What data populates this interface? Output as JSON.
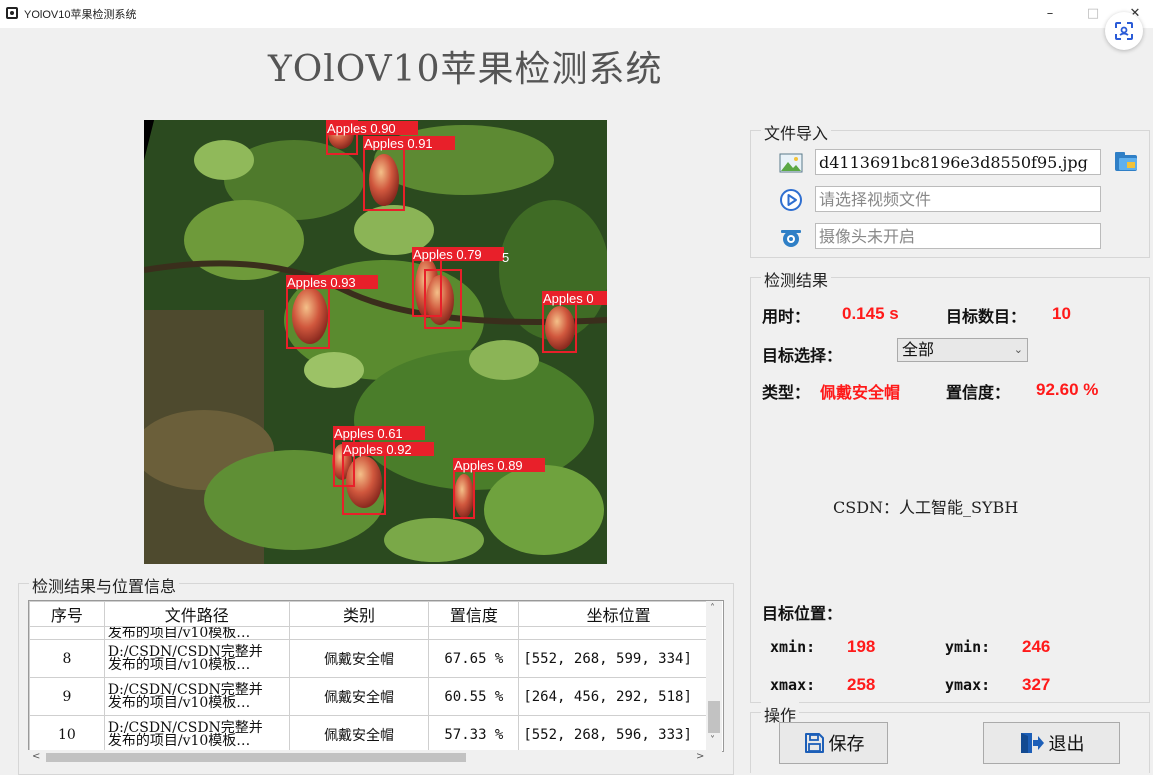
{
  "window": {
    "title": "YOlOV10苹果检测系统",
    "minimize": "–",
    "maximize": "□",
    "close": "✕"
  },
  "main_title": "YOlOV10苹果检测系统",
  "detections": [
    {
      "label": "Apples 0.90"
    },
    {
      "label": "Apples 0.91"
    },
    {
      "label": "Apples 0.79"
    },
    {
      "label": "5"
    },
    {
      "label": "Apples 0.93"
    },
    {
      "label": "Apples 0"
    },
    {
      "label": "Apples 0.61"
    },
    {
      "label": "Apples 0.92"
    },
    {
      "label": "Apples 0.89"
    }
  ],
  "file_import": {
    "title": "文件导入",
    "image_value": "d4113691bc8196e3d8550f95.jpg",
    "video_placeholder": "请选择视频文件",
    "camera_placeholder": "摄像头未开启"
  },
  "result": {
    "title": "检测结果",
    "time_label": "用时：",
    "time_value": "0.145 s",
    "count_label": "目标数目：",
    "count_value": "10",
    "select_label": "目标选择：",
    "select_value": "全部",
    "type_label": "类型：",
    "type_value": "佩戴安全帽",
    "conf_label": "置信度：",
    "conf_value": "92.60 %",
    "csdn": "CSDN：人工智能_SYBH",
    "pos_label": "目标位置：",
    "xmin_label": "xmin:",
    "xmin_value": "198",
    "ymin_label": "ymin:",
    "ymin_value": "246",
    "xmax_label": "xmax:",
    "xmax_value": "258",
    "ymax_label": "ymax:",
    "ymax_value": "327"
  },
  "operations": {
    "title": "操作",
    "save": "保存",
    "exit": "退出"
  },
  "table": {
    "title": "检测结果与位置信息",
    "headers": [
      "序号",
      "文件路径",
      "类别",
      "置信度",
      "坐标位置"
    ],
    "partial_row": {
      "path": "发布的项目/v10模板…"
    },
    "rows": [
      {
        "index": "8",
        "path1": "D:/CSDN/CSDN完整并",
        "path2": "发布的项目/v10模板…",
        "cls": "佩戴安全帽",
        "conf": "67.65 %",
        "coord": "[552, 268, 599, 334]"
      },
      {
        "index": "9",
        "path1": "D:/CSDN/CSDN完整并",
        "path2": "发布的项目/v10模板…",
        "cls": "佩戴安全帽",
        "conf": "60.55 %",
        "coord": "[264, 456, 292, 518]"
      },
      {
        "index": "10",
        "path1": "D:/CSDN/CSDN完整并",
        "path2": "发布的项目/v10模板…",
        "cls": "佩戴安全帽",
        "conf": "57.33 %",
        "coord": "[552, 268, 596, 333]"
      }
    ]
  },
  "colors": {
    "accent_red": "#ff1a1a",
    "box_red": "#e8202a",
    "background": "#f0f0f0"
  }
}
